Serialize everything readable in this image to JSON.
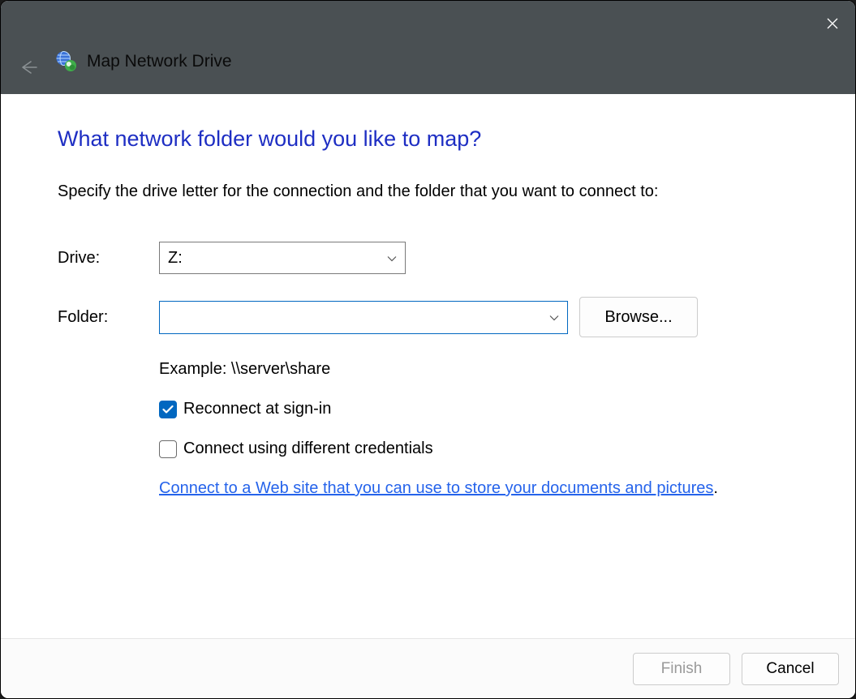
{
  "header": {
    "title": "Map Network Drive"
  },
  "main": {
    "heading": "What network folder would you like to map?",
    "instruction": "Specify the drive letter for the connection and the folder that you want to connect to:",
    "drive_label": "Drive:",
    "drive_value": "Z:",
    "folder_label": "Folder:",
    "folder_value": "",
    "browse_label": "Browse...",
    "example_text": "Example: \\\\server\\share",
    "reconnect_label": "Reconnect at sign-in",
    "reconnect_checked": true,
    "different_creds_label": "Connect using different credentials",
    "different_creds_checked": false,
    "link_text": "Connect to a Web site that you can use to store your documents and pictures",
    "link_trailing": "."
  },
  "footer": {
    "finish_label": "Finish",
    "finish_enabled": false,
    "cancel_label": "Cancel"
  },
  "icons": {
    "close": "close-icon",
    "back": "back-arrow-icon",
    "app": "network-drive-icon",
    "chevron": "chevron-down-icon",
    "check": "checkmark-icon"
  }
}
